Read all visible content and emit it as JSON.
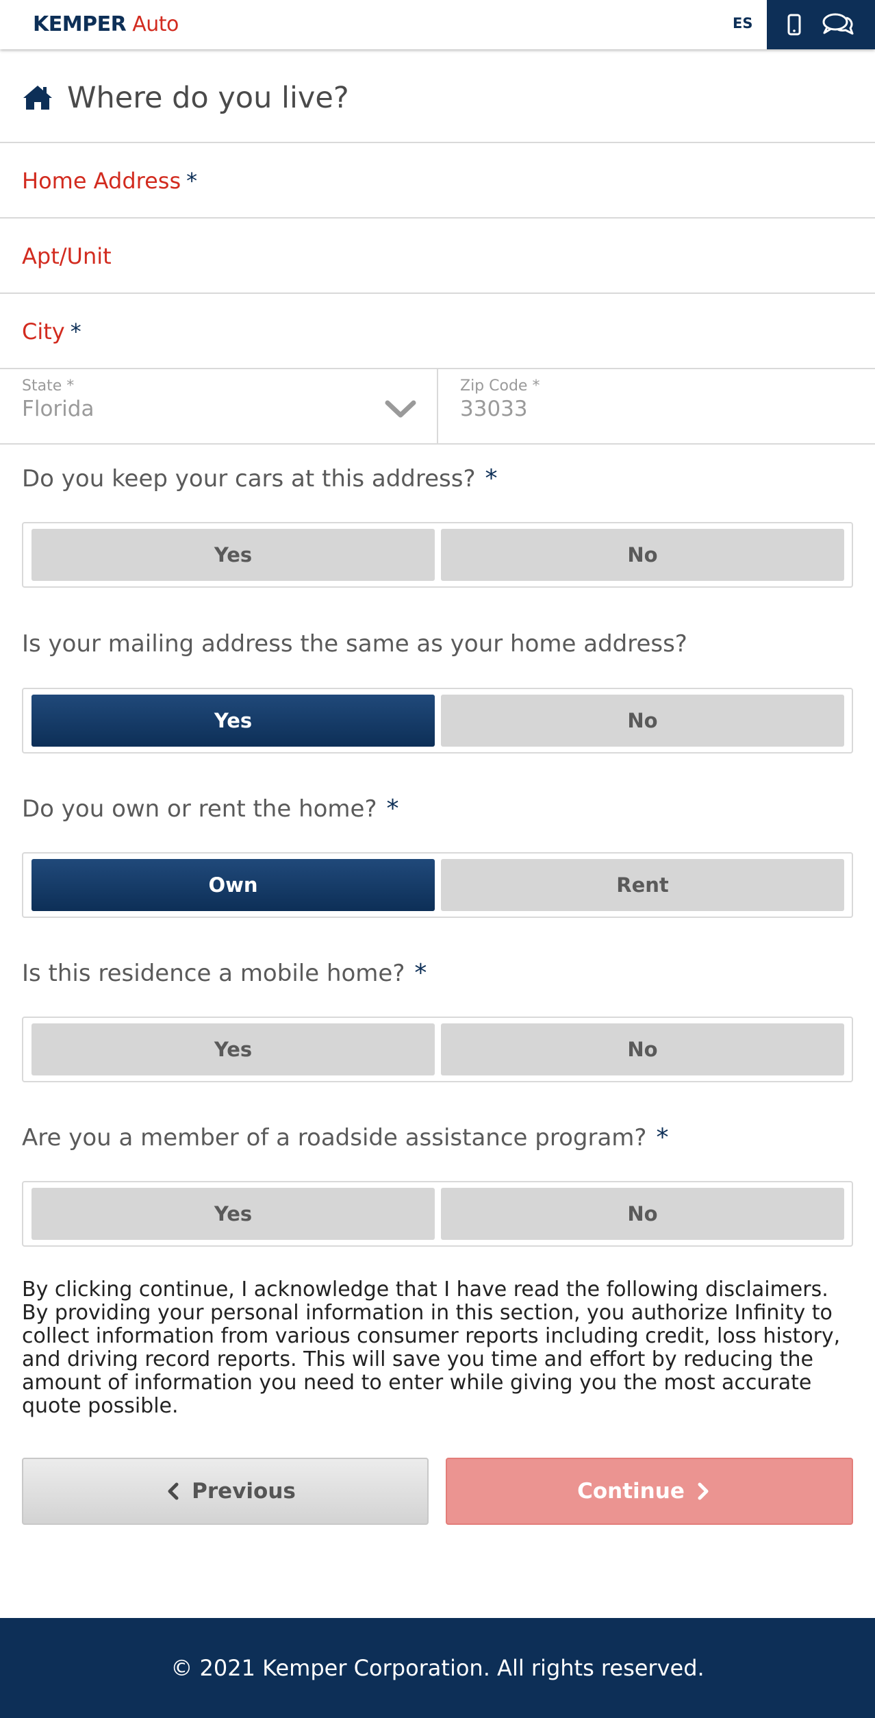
{
  "header": {
    "brand_primary": "KEMPER",
    "brand_secondary": "Auto",
    "language_toggle": "ES",
    "phone_icon": "mobile-phone-icon",
    "chat_icon": "chat-bubbles-icon"
  },
  "page": {
    "title": "Where do you live?",
    "title_icon": "home-icon"
  },
  "form": {
    "home_address": {
      "label": "Home Address",
      "required": "*",
      "value": ""
    },
    "apt_unit": {
      "label": "Apt/Unit",
      "value": ""
    },
    "city": {
      "label": "City",
      "required": "*",
      "value": ""
    },
    "state": {
      "label": "State *",
      "value": "Florida"
    },
    "zip": {
      "label": "Zip Code *",
      "value": "33033"
    }
  },
  "questions": [
    {
      "text": "Do you keep your cars at this address?",
      "required": "*",
      "options": [
        "Yes",
        "No"
      ],
      "selected": ""
    },
    {
      "text": "Is your mailing address the same as your home address?",
      "required": "",
      "options": [
        "Yes",
        "No"
      ],
      "selected": "Yes"
    },
    {
      "text": "Do you own or rent the home?",
      "required": "*",
      "options": [
        "Own",
        "Rent"
      ],
      "selected": "Own"
    },
    {
      "text": "Is this residence a mobile home?",
      "required": "*",
      "options": [
        "Yes",
        "No"
      ],
      "selected": ""
    },
    {
      "text": "Are you a member of a roadside assistance program?",
      "required": "*",
      "options": [
        "Yes",
        "No"
      ],
      "selected": ""
    }
  ],
  "disclaimer": "By clicking continue, I acknowledge that I have read the following disclaimers. By providing your personal information in this section, you authorize Infinity to collect information from various consumer reports including credit, loss history, and driving record reports. This will save you time and effort by reducing the amount of information you need to enter while giving you the most accurate quote possible.",
  "nav": {
    "previous": "Previous",
    "continue": "Continue"
  },
  "footer": {
    "copyright": "© 2021 Kemper Corporation. All rights reserved."
  },
  "colors": {
    "brand_navy": "#0d2f57",
    "brand_red": "#d22b1f",
    "continue_disabled": "#eb9491",
    "option_bg": "#d6d6d6"
  }
}
